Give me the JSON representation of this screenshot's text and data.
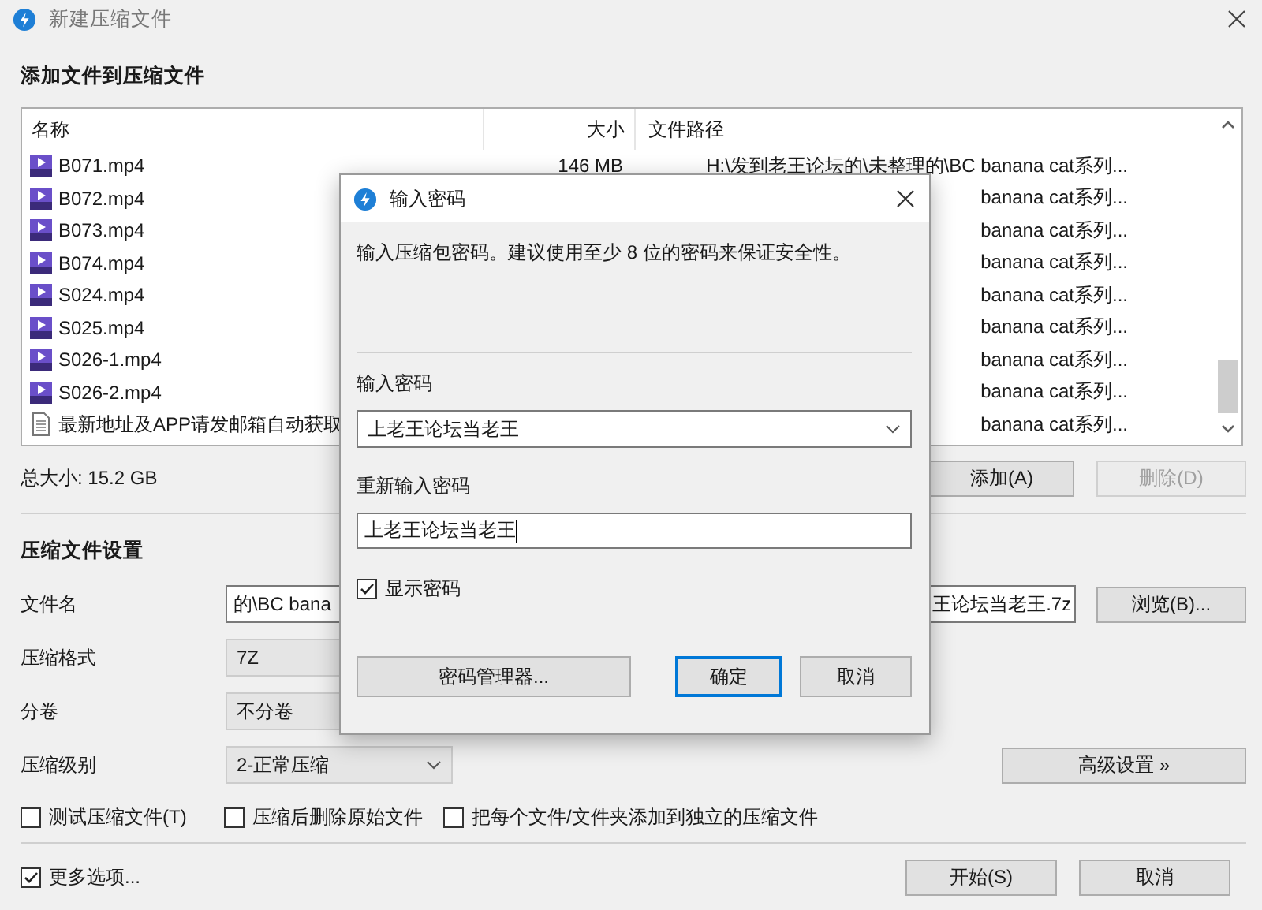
{
  "window": {
    "title": "新建压缩文件"
  },
  "add_section": {
    "title": "添加文件到压缩文件"
  },
  "file_list": {
    "columns": [
      "名称",
      "大小",
      "文件路径"
    ],
    "rows": [
      {
        "kind": "video",
        "name": "B071.mp4",
        "size": "146 MB",
        "path": "H:\\发到老王论坛的\\未整理的\\BC banana cat系列..."
      },
      {
        "kind": "video",
        "name": "B072.mp4",
        "path": "banana cat系列..."
      },
      {
        "kind": "video",
        "name": "B073.mp4",
        "path": "banana cat系列..."
      },
      {
        "kind": "video",
        "name": "B074.mp4",
        "path": "banana cat系列..."
      },
      {
        "kind": "video",
        "name": "S024.mp4",
        "path": "banana cat系列..."
      },
      {
        "kind": "video",
        "name": "S025.mp4",
        "path": "banana cat系列..."
      },
      {
        "kind": "video",
        "name": "S026-1.mp4",
        "path": "banana cat系列..."
      },
      {
        "kind": "video",
        "name": "S026-2.mp4",
        "path": "banana cat系列..."
      },
      {
        "kind": "text",
        "name": "最新地址及APP请发邮箱自动获取",
        "path": "banana cat系列..."
      }
    ]
  },
  "total_size": "总大小: 15.2 GB",
  "list_buttons": [
    {
      "label": "添加(A)",
      "disabled": false
    },
    {
      "label": "删除(D)",
      "disabled": true
    }
  ],
  "settings": {
    "title": "压缩文件设置",
    "filename": {
      "label": "文件名",
      "value_start": "的\\BC bana",
      "value_end": "王论坛当老王.7z"
    },
    "browse": "浏览(B)...",
    "format": {
      "label": "压缩格式",
      "value": "7Z"
    },
    "volume": {
      "label": "分卷",
      "value": "不分卷"
    },
    "level": {
      "label": "压缩级别",
      "value": "2-正常压缩"
    },
    "advanced": "高级设置 »",
    "options": [
      {
        "label": "测试压缩文件(T)",
        "checked": false
      },
      {
        "label": "压缩后删除原始文件",
        "checked": false
      },
      {
        "label": "把每个文件/文件夹添加到独立的压缩文件",
        "checked": false
      }
    ]
  },
  "more_options": {
    "label": "更多选项...",
    "checked": true
  },
  "buttons": [
    "开始(S)",
    "取消"
  ],
  "password_dialog": {
    "title": "输入密码",
    "hint": "输入压缩包密码。建议使用至少 8 位的密码来保证安全性。",
    "password_label": "输入密码",
    "password": "上老王论坛当老王",
    "confirm_label": "重新输入密码",
    "confirm": "上老王论坛当老王",
    "show_password": {
      "label": "显示密码",
      "checked": true
    },
    "manager_button": "密码管理器...",
    "buttons": [
      {
        "label": "确定",
        "default": true
      },
      {
        "label": "取消",
        "default": false
      }
    ]
  }
}
